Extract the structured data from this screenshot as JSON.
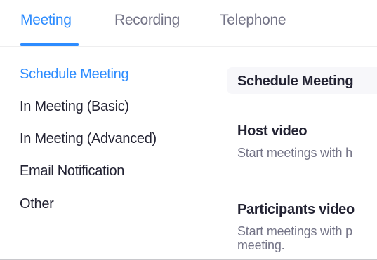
{
  "tabs": [
    {
      "label": "Meeting",
      "active": true
    },
    {
      "label": "Recording",
      "active": false
    },
    {
      "label": "Telephone",
      "active": false
    }
  ],
  "sidebar": {
    "items": [
      {
        "label": "Schedule Meeting",
        "active": true
      },
      {
        "label": "In Meeting (Basic)",
        "active": false
      },
      {
        "label": "In Meeting (Advanced)",
        "active": false
      },
      {
        "label": "Email Notification",
        "active": false
      },
      {
        "label": "Other",
        "active": false
      }
    ]
  },
  "main": {
    "section_title": "Schedule Meeting",
    "settings": [
      {
        "title": "Host video",
        "description": "Start meetings with h"
      },
      {
        "title": "Participants video",
        "description_line1": "Start meetings with p",
        "description_line2": "meeting."
      }
    ]
  },
  "colors": {
    "accent": "#2d8cff",
    "text": "#232333",
    "muted": "#747487",
    "header_bg": "#f7f7fa"
  }
}
